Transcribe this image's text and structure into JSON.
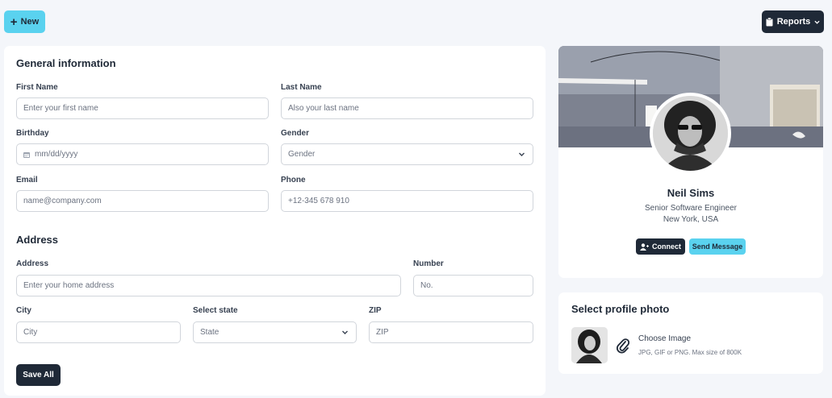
{
  "toolbar": {
    "new_label": "New",
    "reports_label": "Reports"
  },
  "general": {
    "title": "General information",
    "first_name": {
      "label": "First Name",
      "placeholder": "Enter your first name"
    },
    "last_name": {
      "label": "Last Name",
      "placeholder": "Also your last name"
    },
    "birthday": {
      "label": "Birthday",
      "placeholder": "mm/dd/yyyy"
    },
    "gender": {
      "label": "Gender",
      "value": "Gender"
    },
    "email": {
      "label": "Email",
      "placeholder": "name@company.com"
    },
    "phone": {
      "label": "Phone",
      "placeholder": "+12-345 678 910"
    }
  },
  "address": {
    "title": "Address",
    "address": {
      "label": "Address",
      "placeholder": "Enter your home address"
    },
    "number": {
      "label": "Number",
      "placeholder": "No."
    },
    "city": {
      "label": "City",
      "placeholder": "City"
    },
    "state": {
      "label": "Select state",
      "value": "State"
    },
    "zip": {
      "label": "ZIP",
      "placeholder": "ZIP"
    }
  },
  "save_label": "Save All",
  "profile": {
    "name": "Neil Sims",
    "title": "Senior Software Engineer",
    "location": "New York, USA",
    "connect_label": "Connect",
    "message_label": "Send Message"
  },
  "photo": {
    "title": "Select profile photo",
    "choose_label": "Choose Image",
    "hint": "JPG, GIF or PNG. Max size of 800K"
  },
  "colors": {
    "accent": "#5ad2ef",
    "dark": "#1f2937",
    "background": "#f4f6fa"
  },
  "icons": [
    "plus-icon",
    "clipboard-icon",
    "chevron-down-icon",
    "calendar-icon",
    "user-plus-icon",
    "paperclip-icon"
  ]
}
